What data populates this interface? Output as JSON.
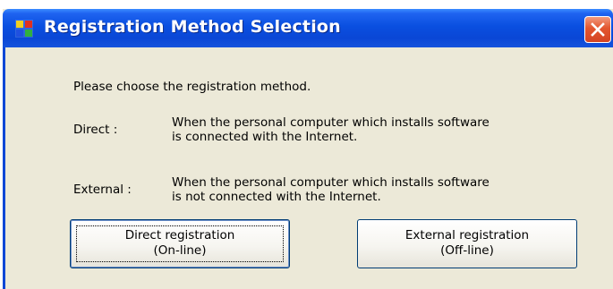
{
  "window": {
    "title": "Registration Method Selection",
    "close_icon": "close-icon",
    "app_icon": "windows-app-icon"
  },
  "content": {
    "prompt": "Please choose the registration method.",
    "direct": {
      "label": "Direct :",
      "description_line1": "When the personal computer which installs software",
      "description_line2": "is connected with the Internet."
    },
    "external": {
      "label": "External :",
      "description_line1": "When the personal computer which installs software",
      "description_line2": "is not connected with the Internet."
    }
  },
  "buttons": {
    "direct": {
      "line1": "Direct registration",
      "line2": "(On-line)"
    },
    "external": {
      "line1": "External registration",
      "line2": "(Off-line)"
    }
  },
  "colors": {
    "titlebar": "#0a47d6",
    "title_text": "#ffffff",
    "close_button": "#e3562f",
    "dialog_background": "#ece9d8",
    "button_border": "#003c74"
  }
}
